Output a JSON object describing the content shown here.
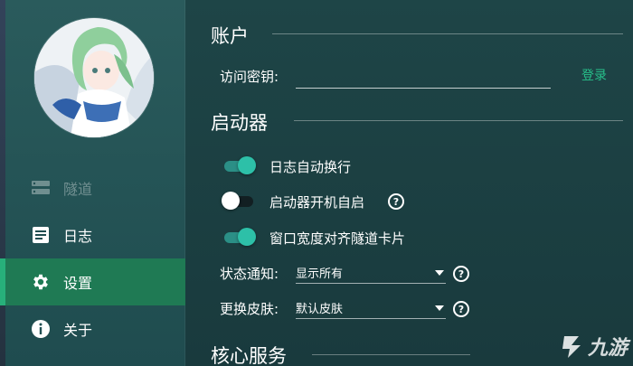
{
  "sidebar": {
    "items": [
      {
        "label": "隧道",
        "icon": "server-icon",
        "state": "disabled"
      },
      {
        "label": "日志",
        "icon": "log-icon",
        "state": "normal"
      },
      {
        "label": "设置",
        "icon": "gear-icon",
        "state": "active"
      },
      {
        "label": "关于",
        "icon": "info-icon",
        "state": "normal"
      }
    ]
  },
  "account": {
    "title": "账户",
    "key_label": "访问密钥:",
    "key_value": "",
    "login_label": "登录"
  },
  "launcher": {
    "title": "启动器",
    "options": [
      {
        "label": "日志自动换行",
        "enabled": true
      },
      {
        "label": "启动器开机自启",
        "enabled": false
      },
      {
        "label": "窗口宽度对齐隧道卡片",
        "enabled": true
      }
    ],
    "notify_label": "状态通知:",
    "notify_value": "显示所有",
    "skin_label": "更换皮肤:",
    "skin_value": "默认皮肤"
  },
  "core": {
    "title": "核心服务"
  },
  "watermark": {
    "text": "九游"
  },
  "colors": {
    "accent": "#27c08a",
    "active_nav": "#1f7a54",
    "switch_on": "#2dc0a8"
  }
}
